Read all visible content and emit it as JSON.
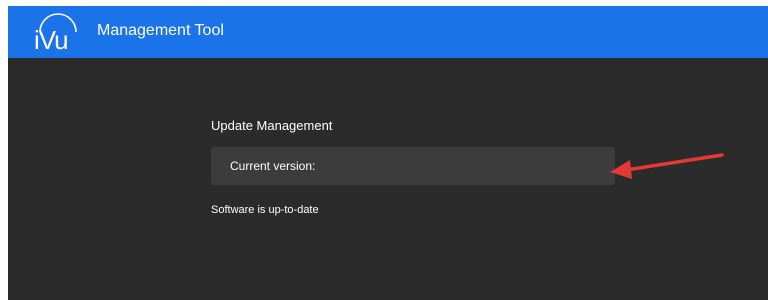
{
  "header": {
    "logo_text": "iVu",
    "title": "Management Tool",
    "background_color": "#1a73e8"
  },
  "main": {
    "section_title": "Update Management",
    "version_label": "Current version:",
    "status_text": "Software is up-to-date",
    "background_color": "#2b2b2b",
    "panel_color": "#3c3c3c"
  },
  "annotation": {
    "icon": "red-arrow-icon",
    "color": "#e53935"
  }
}
